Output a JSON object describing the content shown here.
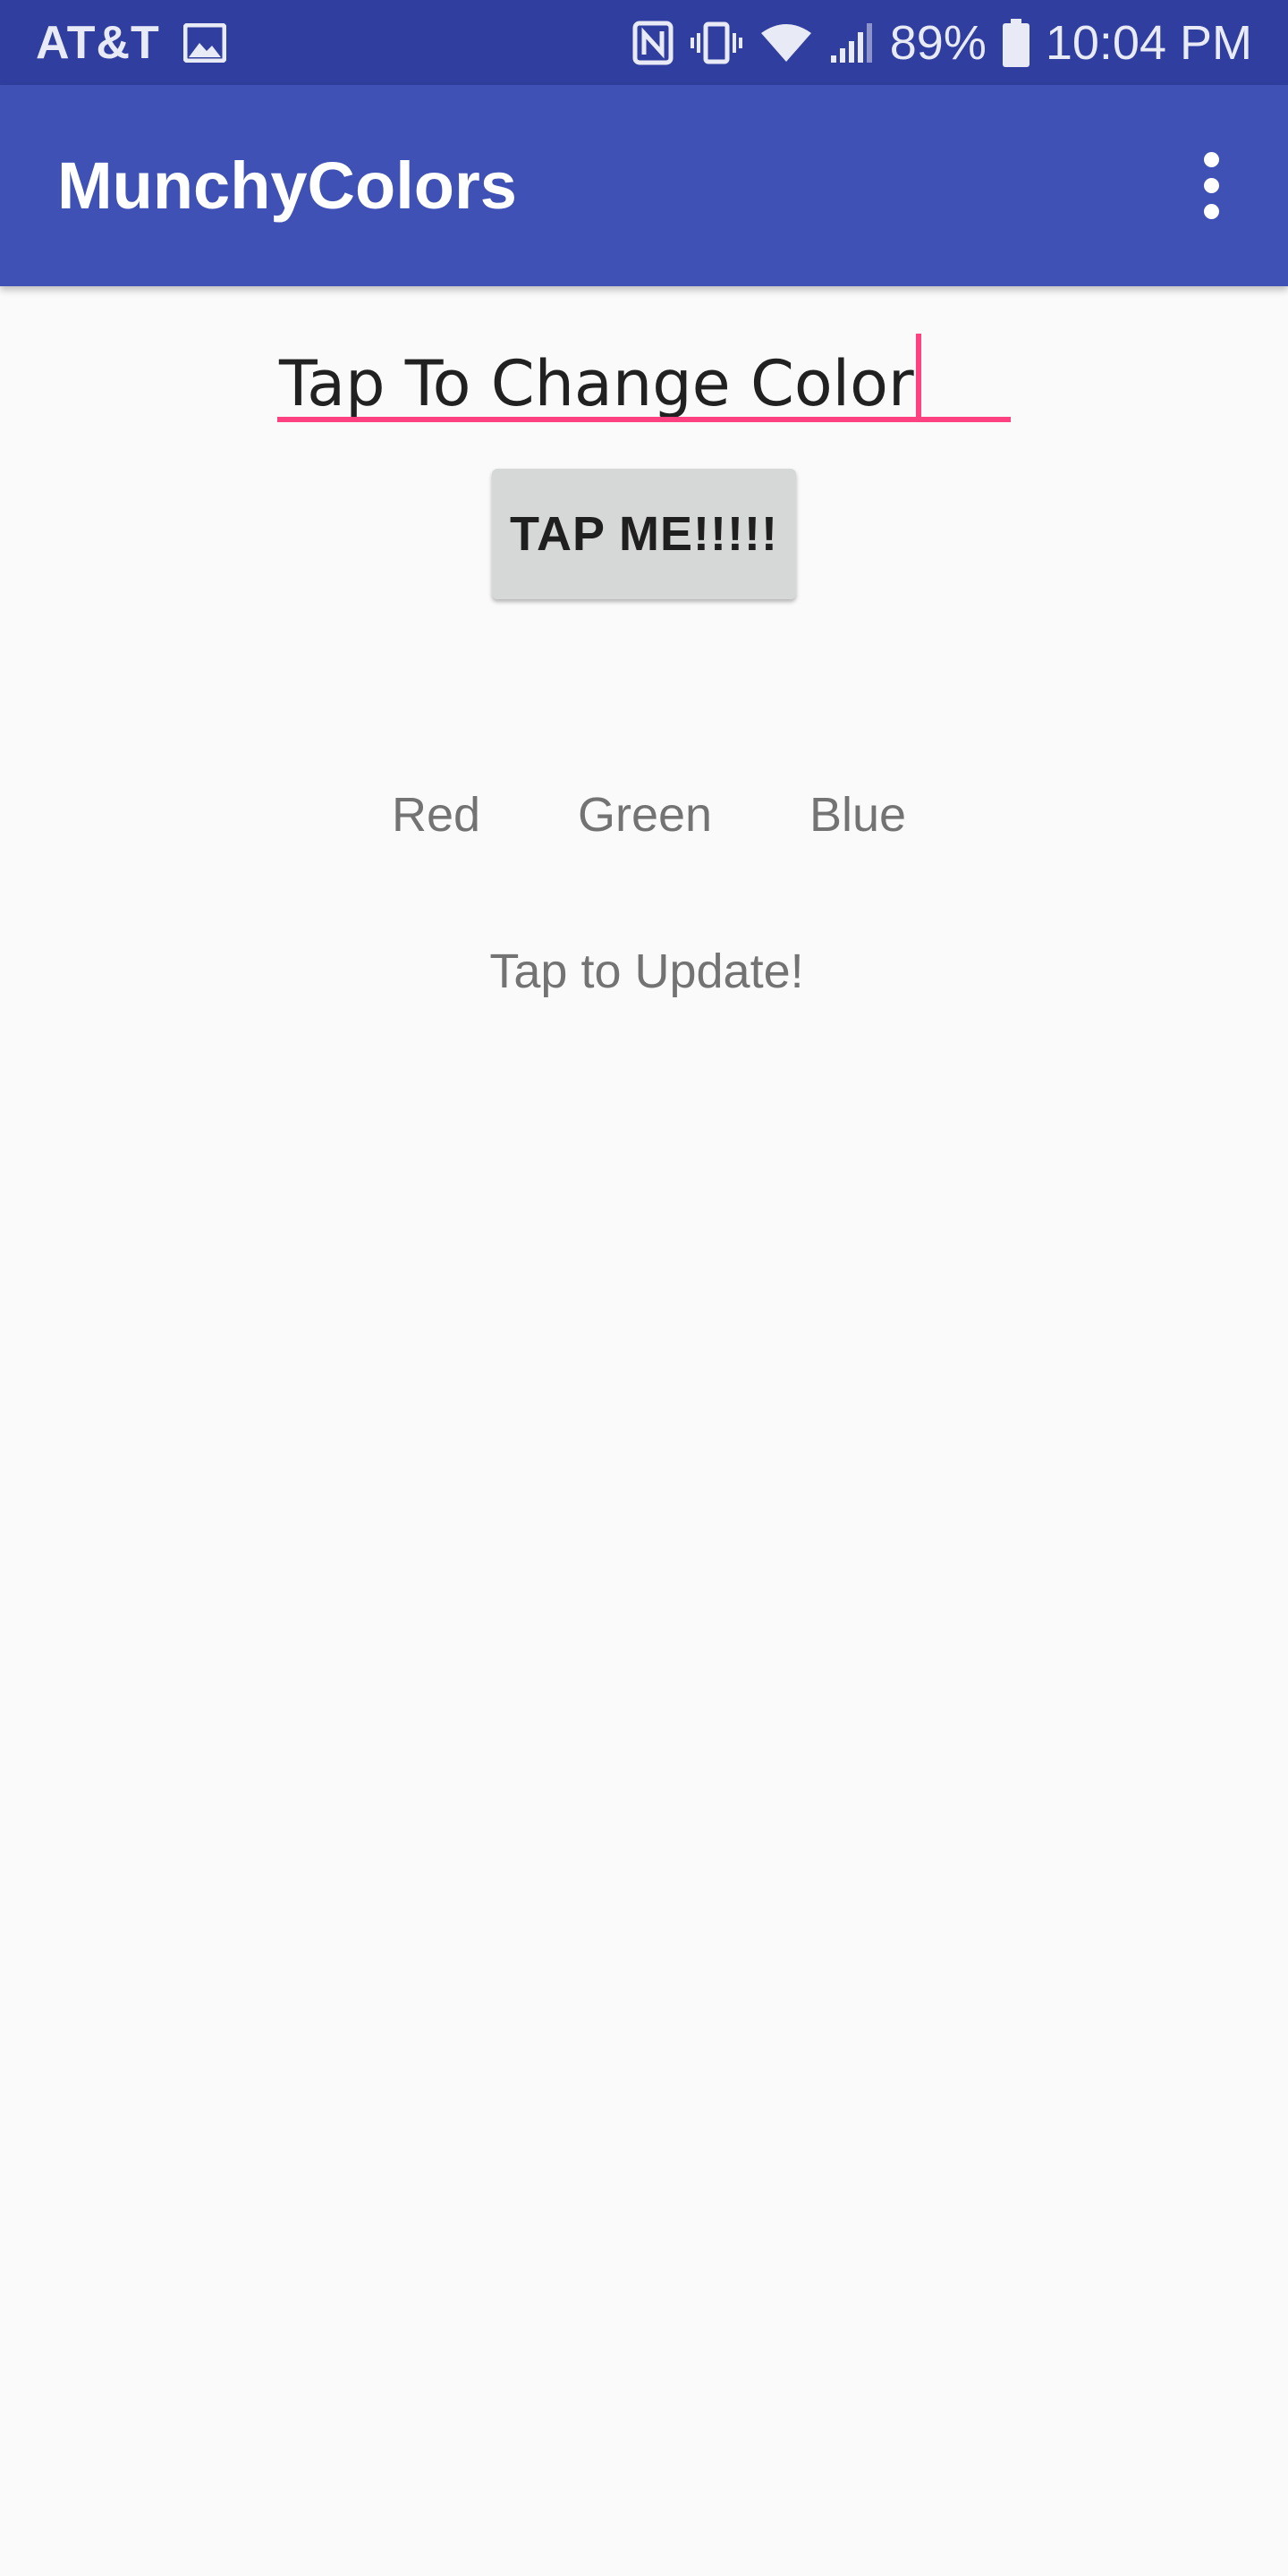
{
  "status_bar": {
    "carrier": "AT&T",
    "battery_percent": "89%",
    "time": "10:04 PM",
    "icons": [
      "image-icon",
      "nfc-icon",
      "vibrate-icon",
      "wifi-icon",
      "signal-icon",
      "battery-icon"
    ],
    "background": "#303f9f"
  },
  "app_bar": {
    "title": "MunchyColors",
    "background": "#3f51b5",
    "menu_icon": "more-vert-icon"
  },
  "color_input": {
    "value": "Tap To Change Color",
    "accent": "#ff4081"
  },
  "tap_button": {
    "label": "TAP ME!!!!!"
  },
  "rgb": {
    "red_label": "Red",
    "green_label": "Green",
    "blue_label": "Blue"
  },
  "update": {
    "label": "Tap to Update!"
  }
}
